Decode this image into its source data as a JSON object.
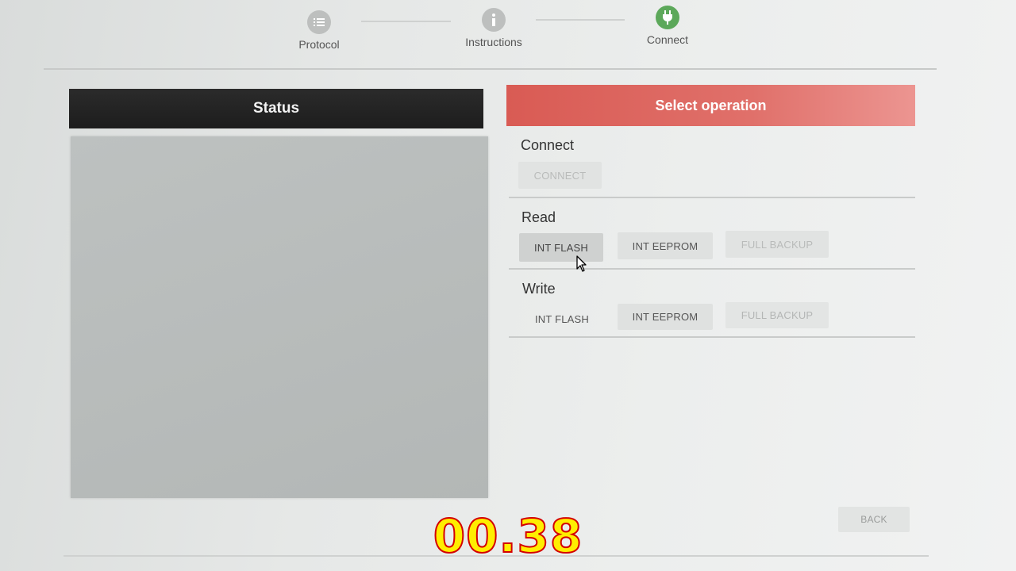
{
  "stepper": {
    "steps": [
      {
        "label": "Protocol",
        "icon": "list-icon",
        "state": "done"
      },
      {
        "label": "Instructions",
        "icon": "info-icon",
        "state": "done"
      },
      {
        "label": "Connect",
        "icon": "plug-icon",
        "state": "active"
      }
    ]
  },
  "status_panel": {
    "title": "Status"
  },
  "operation_panel": {
    "title": "Select operation",
    "sections": {
      "connect": {
        "title": "Connect",
        "buttons": [
          "CONNECT"
        ]
      },
      "read": {
        "title": "Read",
        "buttons": [
          "INT FLASH",
          "INT EEPROM",
          "FULL BACKUP"
        ]
      },
      "write": {
        "title": "Write",
        "buttons": [
          "INT FLASH",
          "INT EEPROM",
          "FULL BACKUP"
        ]
      }
    }
  },
  "footer": {
    "back_label": "BACK"
  },
  "overlay": {
    "timer": "00.38"
  },
  "colors": {
    "active_step": "#5ca85a",
    "operation_header": "#d95b54",
    "status_header": "#222222",
    "timer_fill": "#ffee00",
    "timer_outline": "#d40000"
  }
}
